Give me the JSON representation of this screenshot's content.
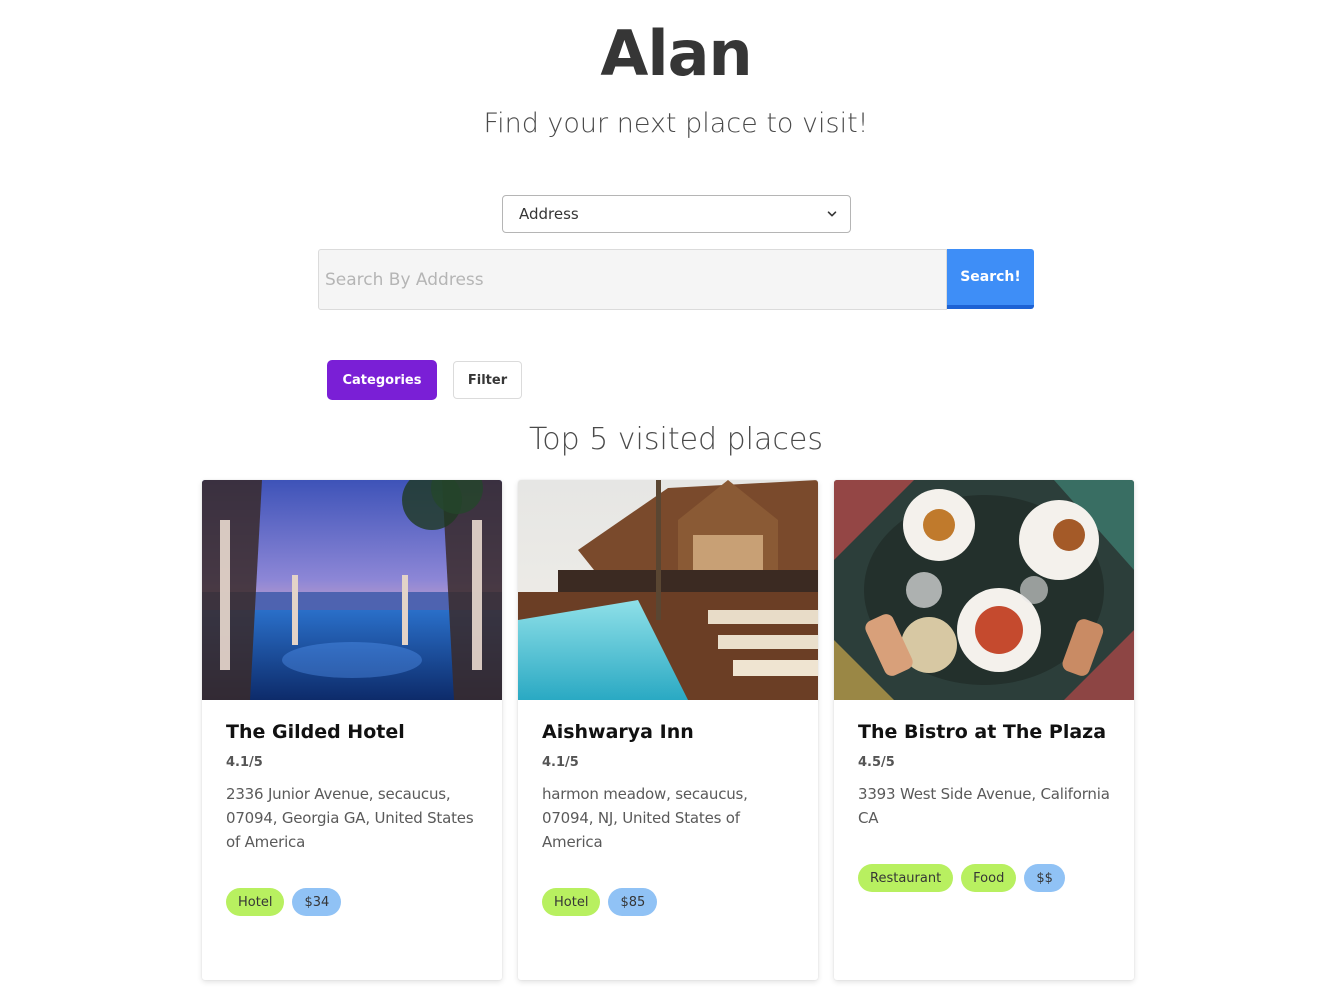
{
  "header": {
    "logo": "Alan",
    "tagline": "Find your next place to visit!"
  },
  "search": {
    "select_value": "Address",
    "placeholder": "Search By Address",
    "value": "",
    "button_label": "Search!"
  },
  "controls": {
    "categories_label": "Categories",
    "filter_label": "Filter"
  },
  "section_title": "Top 5 visited places",
  "colors": {
    "accent_purple": "#7a1fd6",
    "search_blue": "#3e8ef7",
    "tag_green": "#b8f060",
    "tag_blue": "#90c2f5"
  },
  "cards": [
    {
      "title": "The Gilded Hotel",
      "rating": "4.1/5",
      "address": "2336 Junior Avenue, secaucus, 07094, Georgia GA, United States of America",
      "tags": [
        {
          "label": "Hotel",
          "color": "green"
        },
        {
          "label": "$34",
          "color": "blue"
        }
      ]
    },
    {
      "title": "Aishwarya Inn",
      "rating": "4.1/5",
      "address": "harmon meadow, secaucus, 07094, NJ, United States of America",
      "tags": [
        {
          "label": "Hotel",
          "color": "green"
        },
        {
          "label": "$85",
          "color": "blue"
        }
      ]
    },
    {
      "title": "The Bistro at The Plaza",
      "rating": "4.5/5",
      "address": "3393 West Side Avenue, California CA",
      "tags": [
        {
          "label": "Restaurant",
          "color": "green"
        },
        {
          "label": "Food",
          "color": "green"
        },
        {
          "label": "$$",
          "color": "blue"
        }
      ]
    }
  ]
}
